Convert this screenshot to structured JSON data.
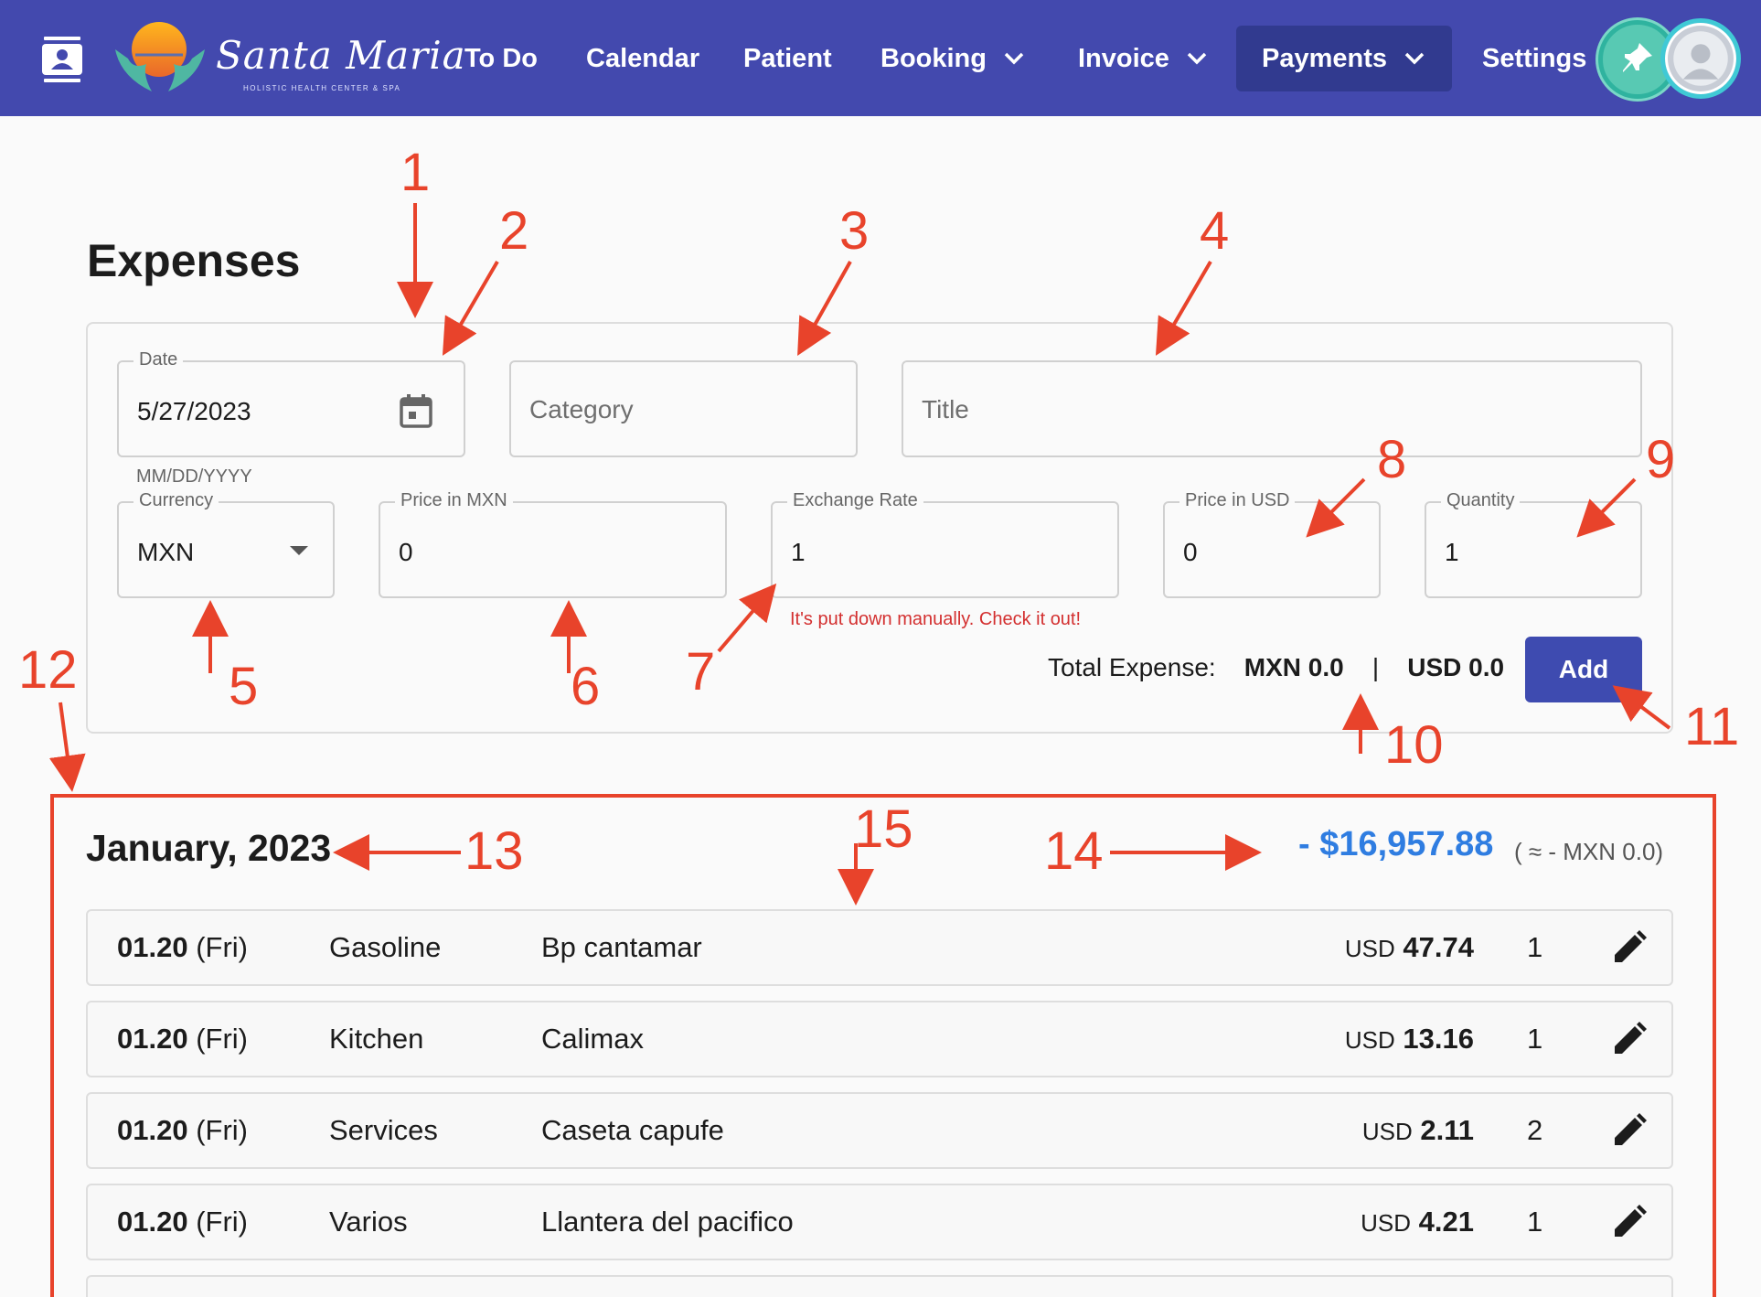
{
  "app": {
    "logo_name": "Santa Maria",
    "logo_subtitle": "HOLISTIC HEALTH CENTER & SPA",
    "brand_color": "#4349ae",
    "accent_color": "#3e4bb0"
  },
  "nav": {
    "items": [
      {
        "label": "To Do"
      },
      {
        "label": "Calendar"
      },
      {
        "label": "Patient"
      },
      {
        "label": "Booking"
      },
      {
        "label": "Invoice"
      },
      {
        "label": "Payments"
      },
      {
        "label": "Settings"
      }
    ],
    "active": "Payments",
    "icons": {
      "menu": "contacts-icon",
      "pin": "pin-icon",
      "user": "user-avatar"
    }
  },
  "page": {
    "title": "Expenses"
  },
  "form": {
    "date": {
      "label": "Date",
      "value": "5/27/2023",
      "helper": "MM/DD/YYYY"
    },
    "category": {
      "placeholder": "Category"
    },
    "title": {
      "placeholder": "Title"
    },
    "currency": {
      "label": "Currency",
      "value": "MXN"
    },
    "price_mxn": {
      "label": "Price in MXN",
      "value": "0"
    },
    "exchange_rate": {
      "label": "Exchange Rate",
      "value": "1",
      "error": "It's put down manually. Check it out!"
    },
    "price_usd": {
      "label": "Price in USD",
      "value": "0"
    },
    "quantity": {
      "label": "Quantity",
      "value": "1"
    },
    "total": {
      "label": "Total Expense:",
      "mxn": "MXN 0.0",
      "separator": "|",
      "usd": "USD 0.0"
    },
    "add_label": "Add"
  },
  "month": {
    "title": "January, 2023",
    "total": "- $16,957.88",
    "approx": "( ≈ - MXN 0.0)"
  },
  "expenses": [
    {
      "date_num": "01.20",
      "date_day": "(Fri)",
      "category": "Gasoline",
      "title": "Bp cantamar",
      "currency": "USD",
      "amount": "47.74",
      "qty": "1"
    },
    {
      "date_num": "01.20",
      "date_day": "(Fri)",
      "category": "Kitchen",
      "title": "Calimax",
      "currency": "USD",
      "amount": "13.16",
      "qty": "1"
    },
    {
      "date_num": "01.20",
      "date_day": "(Fri)",
      "category": "Services",
      "title": "Caseta capufe",
      "currency": "USD",
      "amount": "2.11",
      "qty": "2"
    },
    {
      "date_num": "01.20",
      "date_day": "(Fri)",
      "category": "Varios",
      "title": "Llantera del pacifico",
      "currency": "USD",
      "amount": "4.21",
      "qty": "1"
    }
  ],
  "annotations": [
    "1",
    "2",
    "3",
    "4",
    "5",
    "6",
    "7",
    "8",
    "9",
    "10",
    "11",
    "12",
    "13",
    "14",
    "15"
  ],
  "annotation_color": "#e8432b"
}
